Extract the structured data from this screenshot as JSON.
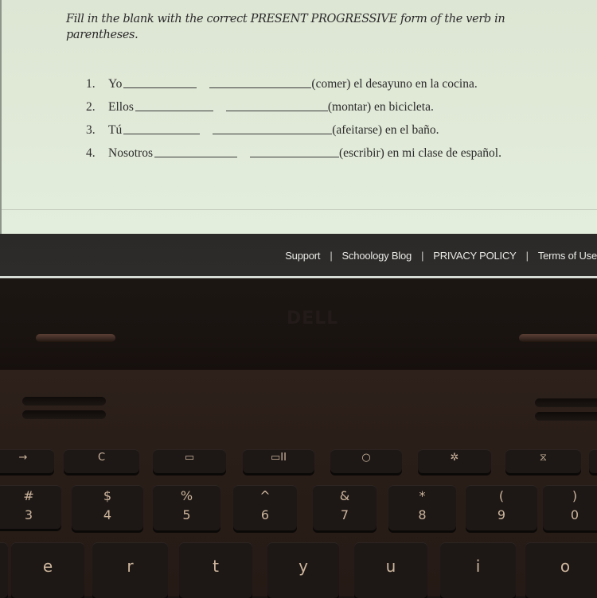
{
  "worksheet": {
    "instructions": "Fill in the blank with the correct PRESENT PROGRESSIVE form of the verb in parentheses.",
    "exercises": [
      {
        "number": "1.",
        "subject": "Yo",
        "rest": "(comer) el desayuno en la cocina."
      },
      {
        "number": "2.",
        "subject": "Ellos",
        "rest": "(montar) en bicicleta."
      },
      {
        "number": "3.",
        "subject": "Tú",
        "rest": "(afeitarse) en el baño."
      },
      {
        "number": "4.",
        "subject": "Nosotros",
        "rest": "(escribir) en mi clase de español."
      }
    ]
  },
  "footer": {
    "links": [
      "Support",
      "Schoology Blog",
      "PRIVACY POLICY",
      "Terms of Use"
    ],
    "separator": "|"
  },
  "laptop": {
    "brand_logo": "DELL",
    "function_row": [
      {
        "icon": "forward-arrow-icon",
        "glyph": "→"
      },
      {
        "icon": "refresh-icon",
        "glyph": "C"
      },
      {
        "icon": "fullscreen-icon",
        "glyph": "▭"
      },
      {
        "icon": "overview-icon",
        "glyph": "▭II"
      },
      {
        "icon": "brightness-down-icon",
        "glyph": "○"
      },
      {
        "icon": "brightness-up-icon",
        "glyph": "✲"
      },
      {
        "icon": "mute-icon",
        "glyph": "⧖"
      }
    ],
    "number_row": [
      {
        "top": "#",
        "bottom": "3"
      },
      {
        "top": "$",
        "bottom": "4"
      },
      {
        "top": "%",
        "bottom": "5"
      },
      {
        "top": "^",
        "bottom": "6"
      },
      {
        "top": "&",
        "bottom": "7"
      },
      {
        "top": "*",
        "bottom": "8"
      },
      {
        "top": "(",
        "bottom": "9"
      },
      {
        "top": ")",
        "bottom": "0"
      }
    ],
    "letter_row": [
      "e",
      "r",
      "t",
      "y",
      "u",
      "i",
      "o"
    ]
  },
  "colors": {
    "page_background": "#e0e8d6",
    "footer_background": "#2b2a28",
    "footer_text": "#e9e9e6",
    "key_legend": "#cdb59c"
  }
}
